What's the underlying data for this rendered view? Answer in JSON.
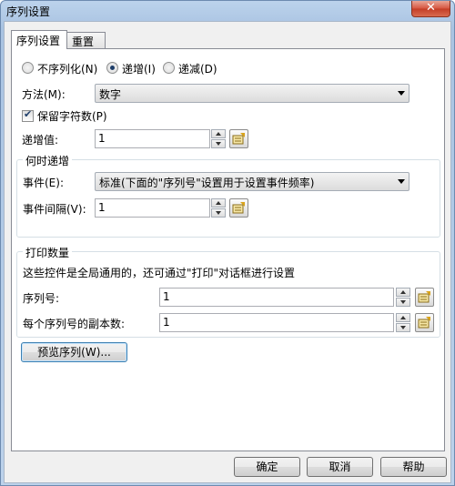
{
  "window": {
    "title": "序列设置",
    "close_glyph": "✕"
  },
  "tabs": [
    {
      "label": "序列设置"
    },
    {
      "label": "重置"
    }
  ],
  "mode": {
    "options": [
      {
        "label": "不序列化(N)",
        "checked": false
      },
      {
        "label": "递增(I)",
        "checked": true
      },
      {
        "label": "递减(D)",
        "checked": false
      }
    ]
  },
  "method": {
    "label": "方法(M):",
    "value": "数字"
  },
  "keep_chars": {
    "label": "保留字符数(P)",
    "checked": true
  },
  "increment": {
    "label": "递增值:",
    "value": "1"
  },
  "when_group": {
    "title": "何时递增",
    "event_label": "事件(E):",
    "event_value": "标准(下面的\"序列号\"设置用于设置事件频率)",
    "interval_label": "事件间隔(V):",
    "interval_value": "1"
  },
  "print_group": {
    "title": "打印数量",
    "note": "这些控件是全局通用的，还可通过\"打印\"对话框进行设置",
    "serial_label": "序列号:",
    "serial_value": "1",
    "copies_label": "每个序列号的副本数:",
    "copies_value": "1"
  },
  "preview_button": "预览序列(W)...",
  "footer": {
    "ok": "确定",
    "cancel": "取消",
    "help": "帮助"
  },
  "icons": {
    "prompt": "prompt-icon",
    "spin_up": "spin-up-icon",
    "spin_down": "spin-down-icon",
    "dropdown": "chevron-down-icon"
  }
}
